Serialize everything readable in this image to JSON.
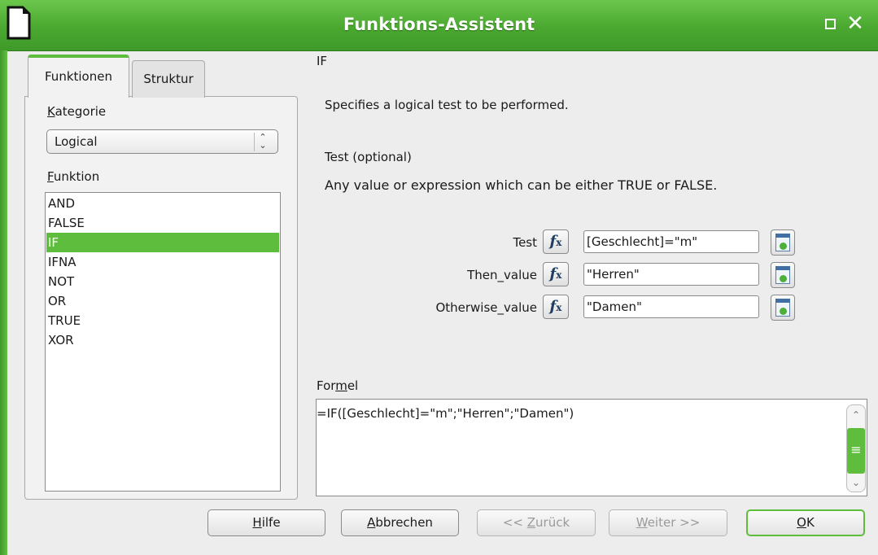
{
  "window": {
    "title": "Funktions-Assistent",
    "colors": {
      "titlebar": "#4aa830",
      "selection": "#5fbd3e",
      "fx_text": "#1d3d63"
    },
    "icons": [
      "libreoffice-icon",
      "maximize-icon",
      "close-icon"
    ]
  },
  "tabs": [
    {
      "label": "Funktionen",
      "active": true
    },
    {
      "label": "Struktur",
      "active": false
    }
  ],
  "category": {
    "label_prefix": "K",
    "label_rest": "ategorie",
    "selected": "Logical"
  },
  "function_list": {
    "label_prefix": "F",
    "label_rest": "unktion",
    "items": [
      "AND",
      "FALSE",
      "IF",
      "IFNA",
      "NOT",
      "OR",
      "TRUE",
      "XOR"
    ],
    "selected": "IF"
  },
  "function_info": {
    "name": "IF",
    "description": "Specifies a logical test to be performed.",
    "arg_title": "Test (optional)",
    "arg_description": "Any value or expression which can be either TRUE or FALSE."
  },
  "arguments": [
    {
      "label": "Test",
      "value": "[Geschlecht]=\"m\""
    },
    {
      "label": "Then_value",
      "value": "\"Herren\""
    },
    {
      "label": "Otherwise_value",
      "value": "\"Damen\""
    }
  ],
  "fx_glyph": "f",
  "fx_sub": "x",
  "formula": {
    "label_a": "For",
    "label_u": "m",
    "label_b": "el",
    "text": "=IF([Geschlecht]=\"m\";\"Herren\";\"Damen\")"
  },
  "buttons": {
    "help": {
      "u": "H",
      "rest": "ilfe"
    },
    "cancel": {
      "u": "A",
      "rest": "bbrechen"
    },
    "back": {
      "pre": "<< ",
      "u": "Z",
      "rest": "urück",
      "enabled": false
    },
    "next": {
      "u": "W",
      "rest": "eiter >>",
      "enabled": false
    },
    "ok": {
      "u": "O",
      "rest": "K"
    }
  }
}
